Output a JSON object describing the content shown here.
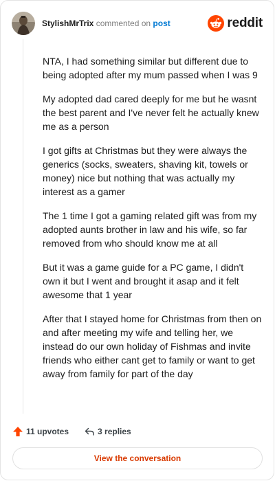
{
  "header": {
    "username": "StylishMrTrix",
    "verb": " commented on ",
    "post_link": "post",
    "brand": "reddit"
  },
  "comment": {
    "paragraphs": [
      "NTA, I had something similar but different due to being adopted after my mum passed when I was 9",
      "My adopted dad cared deeply for me but he wasnt the best parent and I've never felt he actually knew me as a person",
      "I got gifts at Christmas but they were always the generics (socks, sweaters, shaving kit, towels or money) nice but nothing that was actually my interest as a gamer",
      "The 1 time I got a gaming related gift was from my adopted aunts brother in law and his wife, so far removed from who should know me at all",
      "But it was a game guide for a PC game, I didn't own it but I went and brought it asap and it felt awesome that 1 year",
      "After that I stayed home for Christmas from then on and after meeting my wife and telling her, we instead do our own holiday of Fishmas and invite friends who either cant get to family or want to get away from family for part of the day"
    ]
  },
  "footer": {
    "upvotes": "11 upvotes",
    "replies": "3 replies"
  },
  "actions": {
    "view_conversation": "View the conversation"
  },
  "colors": {
    "brand_orange": "#ff4500",
    "link_blue": "#0079d3",
    "cta_text": "#d93a00"
  },
  "icons": {
    "avatar": "avatar-image",
    "brand": "reddit-logo-icon",
    "upvote": "upvote-arrow-icon",
    "reply": "reply-arrow-icon"
  }
}
